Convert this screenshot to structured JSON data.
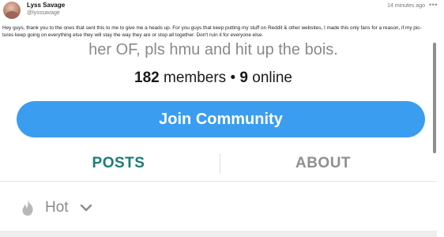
{
  "post": {
    "display_name": "Lyss Savage",
    "handle": "@lysssavage",
    "timestamp": "14 minutes ago",
    "more_icon": "more-horizontal-icon",
    "text_line1": "Hey guys, thank you to the ones that sent this to me to give me a heads up. For you guys that keep putting my stuff on Reddit & other websites, I made this only fans for a reason, if my pic-",
    "text_line2": "tures keep going on everything else they will stay the way they are or stop all together. Don't ruin it for everyone else."
  },
  "community": {
    "description_tail": "her OF, pls hmu and hit up the bois.",
    "members_count": "182",
    "members_label": "members",
    "separator": "•",
    "online_count": "9",
    "online_label": "online",
    "join_label": "Join Community",
    "join_color": "#3a9df0",
    "tabs": [
      {
        "label": "POSTS",
        "active": true,
        "color": "#1a7d76"
      },
      {
        "label": "ABOUT",
        "active": false,
        "color": "#8f8f8f"
      }
    ],
    "sort": {
      "icon": "flame-icon",
      "label": "Hot",
      "chevron": "chevron-down-icon"
    }
  }
}
